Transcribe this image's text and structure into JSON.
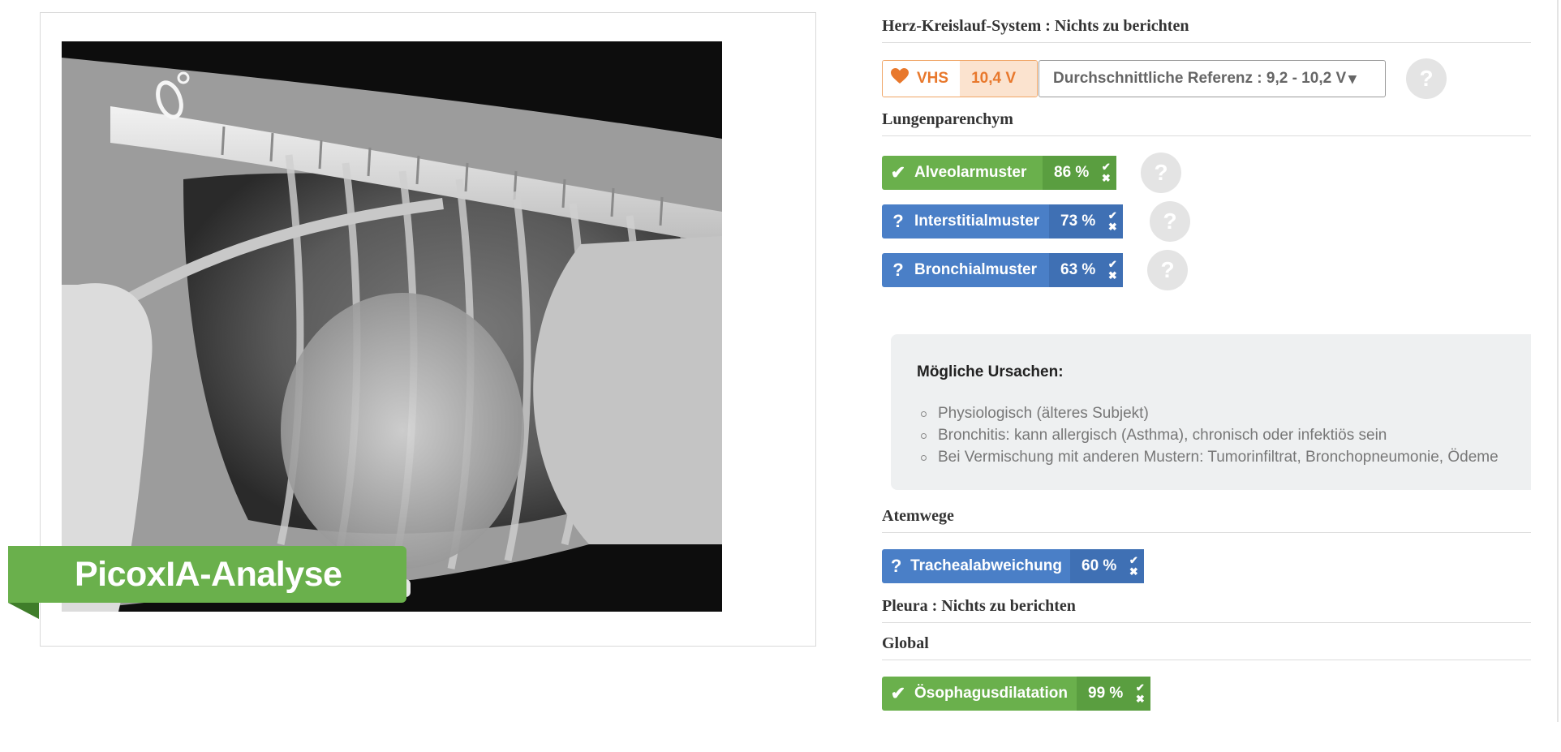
{
  "badge": {
    "label": "PicoxIA-Analyse"
  },
  "cardio": {
    "heading": "Herz-Kreislauf-System : Nichts zu berichten",
    "vhs": {
      "label": "VHS",
      "value": "10,4 V",
      "icon": "heart-icon",
      "color": "#e8782c"
    },
    "reference": {
      "label": "Durchschnittliche Referenz : 9,2 - 10,2 V",
      "caret": "▾"
    }
  },
  "lung": {
    "heading": "Lungenparenchym",
    "findings": [
      {
        "label": "Alveolarmuster",
        "percent": "86 %",
        "state": "confirmed",
        "icon": "✔"
      },
      {
        "label": "Interstitialmuster",
        "percent": "73 %",
        "state": "uncertain",
        "icon": "?"
      },
      {
        "label": "Bronchialmuster",
        "percent": "63 %",
        "state": "uncertain",
        "icon": "?"
      }
    ]
  },
  "causes": {
    "title": "Mögliche Ursachen:",
    "items": [
      "Physiologisch (älteres Subjekt)",
      "Bronchitis: kann allergisch (Asthma), chronisch oder infektiös sein",
      "Bei Vermischung mit anderen Mustern: Tumorinfiltrat, Bronchopneumonie, Ödeme"
    ]
  },
  "airways": {
    "heading": "Atemwege",
    "findings": [
      {
        "label": "Trachealabweichung",
        "percent": "60 %",
        "state": "uncertain",
        "icon": "?"
      }
    ]
  },
  "pleura": {
    "heading": "Pleura : Nichts zu berichten"
  },
  "global": {
    "heading": "Global",
    "findings": [
      {
        "label": "Ösophagusdilatation",
        "percent": "99 %",
        "state": "confirmed",
        "icon": "✔"
      }
    ]
  },
  "controls": {
    "help": "?",
    "vote_up": "✔",
    "vote_down": "✖"
  },
  "colors": {
    "confirmed": "#6ab04c",
    "uncertain": "#4a7fc7",
    "vhs_accent": "#e8782c"
  }
}
